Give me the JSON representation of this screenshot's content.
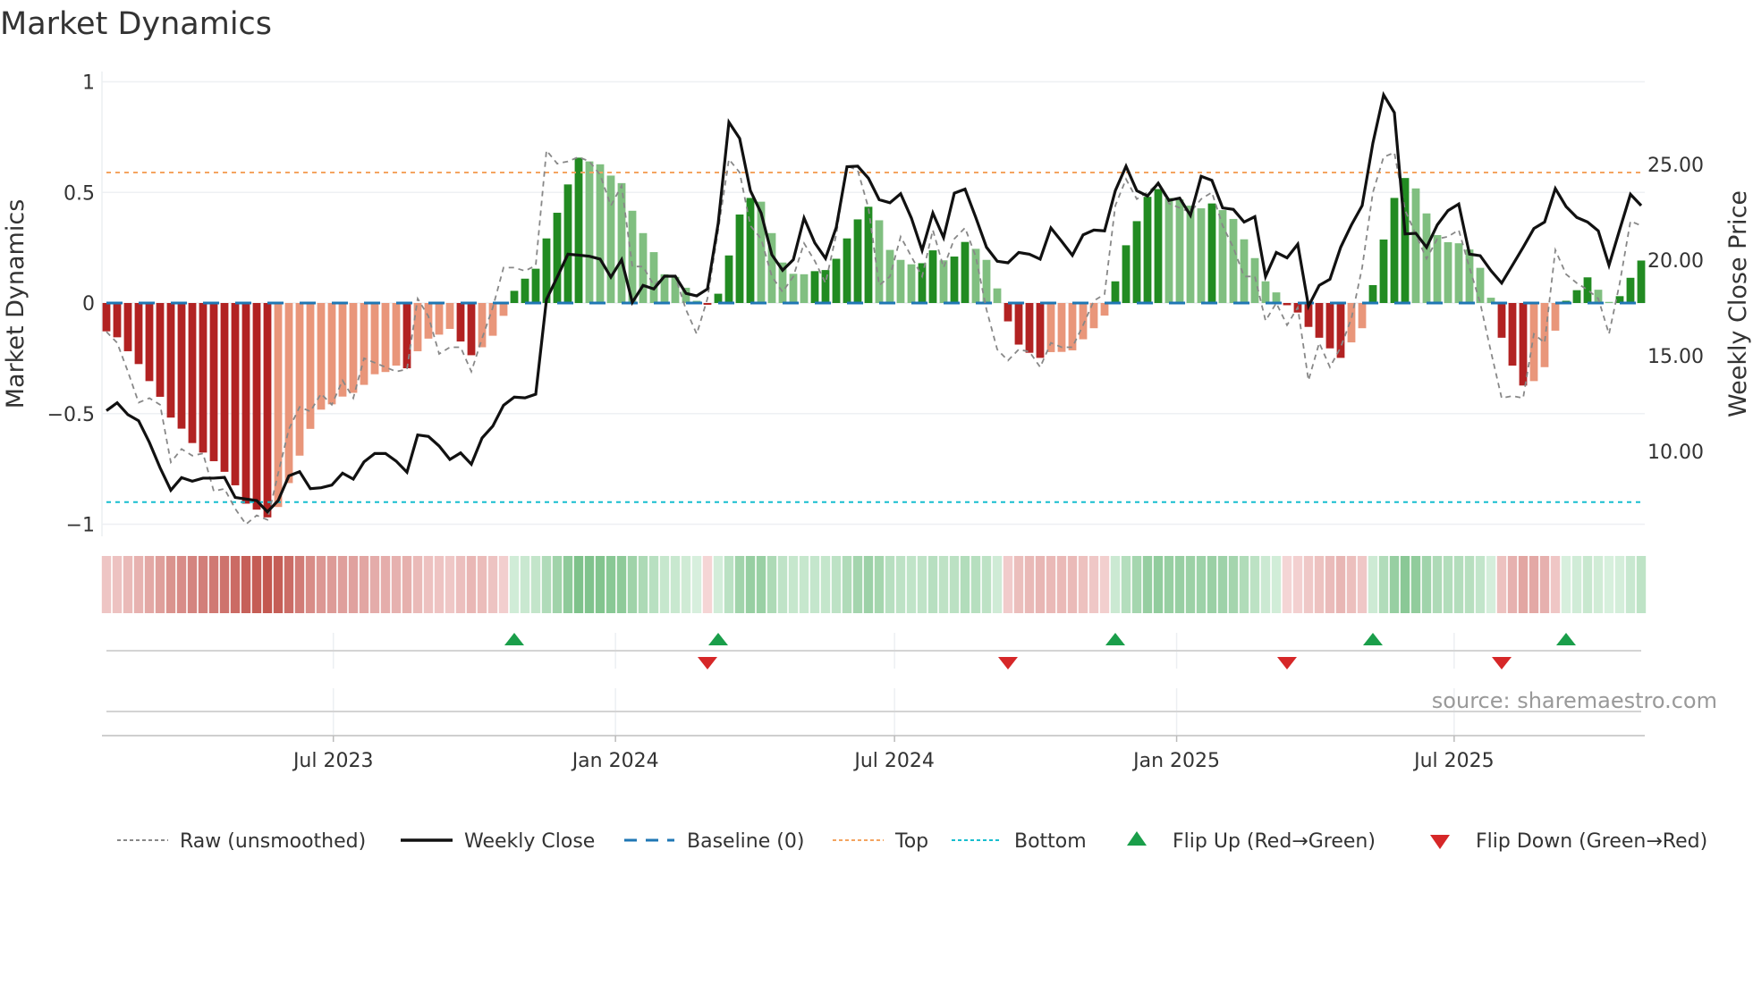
{
  "chart_data": {
    "type": "bar",
    "title": "Market Dynamics",
    "ylabel": "Market Dynamics",
    "y2label": "Weekly Close Price",
    "ylim": [
      -1,
      1
    ],
    "y2lim": [
      5.9,
      29.0
    ],
    "x_start": "2023-02-03",
    "x_interval_days": 7,
    "left_ticks": [
      {
        "value": 1,
        "label": "1"
      },
      {
        "value": 0.5,
        "label": "0.5"
      },
      {
        "value": 0,
        "label": "0"
      },
      {
        "value": -0.5,
        "label": "−0.5"
      },
      {
        "value": -1,
        "label": "−1"
      }
    ],
    "right_ticks": [
      {
        "value": 25,
        "label": "25.00"
      },
      {
        "value": 20,
        "label": "20.00"
      },
      {
        "value": 15,
        "label": "15.00"
      },
      {
        "value": 10,
        "label": "10.00"
      }
    ],
    "x_ticks": [
      {
        "date": "2023-07-01",
        "label": "Jul 2023"
      },
      {
        "date": "2024-01-01",
        "label": "Jan 2024"
      },
      {
        "date": "2024-07-01",
        "label": "Jul 2024"
      },
      {
        "date": "2025-01-01",
        "label": "Jan 2025"
      },
      {
        "date": "2025-07-01",
        "label": "Jul 2025"
      }
    ],
    "top_level": 0.59,
    "bottom_level": -0.9,
    "baseline": 0,
    "dynamics": [
      -0.128,
      -0.155,
      -0.218,
      -0.276,
      -0.353,
      -0.424,
      -0.518,
      -0.568,
      -0.633,
      -0.676,
      -0.715,
      -0.763,
      -0.824,
      -0.907,
      -0.934,
      -0.969,
      -0.922,
      -0.814,
      -0.69,
      -0.569,
      -0.482,
      -0.458,
      -0.423,
      -0.406,
      -0.37,
      -0.322,
      -0.312,
      -0.283,
      -0.295,
      -0.218,
      -0.161,
      -0.143,
      -0.117,
      -0.174,
      -0.236,
      -0.2,
      -0.148,
      -0.058,
      0.055,
      0.11,
      0.155,
      0.292,
      0.408,
      0.536,
      0.657,
      0.64,
      0.627,
      0.576,
      0.542,
      0.417,
      0.316,
      0.23,
      0.13,
      0.118,
      0.069,
      0.01,
      -0.008,
      0.042,
      0.215,
      0.4,
      0.475,
      0.458,
      0.316,
      0.183,
      0.132,
      0.13,
      0.144,
      0.149,
      0.2,
      0.292,
      0.378,
      0.435,
      0.374,
      0.24,
      0.195,
      0.175,
      0.18,
      0.238,
      0.193,
      0.21,
      0.276,
      0.245,
      0.195,
      0.066,
      -0.083,
      -0.188,
      -0.225,
      -0.248,
      -0.222,
      -0.221,
      -0.214,
      -0.164,
      -0.114,
      -0.057,
      0.098,
      0.261,
      0.37,
      0.48,
      0.515,
      0.475,
      0.468,
      0.44,
      0.428,
      0.45,
      0.42,
      0.38,
      0.288,
      0.203,
      0.098,
      0.048,
      -0.01,
      -0.043,
      -0.108,
      -0.157,
      -0.205,
      -0.248,
      -0.178,
      -0.114,
      0.081,
      0.287,
      0.475,
      0.565,
      0.518,
      0.405,
      0.307,
      0.275,
      0.27,
      0.242,
      0.159,
      0.024,
      -0.157,
      -0.283,
      -0.373,
      -0.353,
      -0.29,
      -0.125,
      0.01,
      0.058,
      0.116,
      0.06,
      0.005,
      0.031,
      0.114,
      0.192
    ],
    "raw": [
      -0.13,
      -0.18,
      -0.31,
      -0.45,
      -0.43,
      -0.46,
      -0.72,
      -0.66,
      -0.69,
      -0.68,
      -0.85,
      -0.84,
      -0.93,
      -1.0,
      -0.96,
      -0.98,
      -0.77,
      -0.57,
      -0.47,
      -0.49,
      -0.41,
      -0.46,
      -0.35,
      -0.43,
      -0.25,
      -0.27,
      -0.29,
      -0.31,
      -0.3,
      0.02,
      -0.06,
      -0.23,
      -0.2,
      -0.2,
      -0.31,
      -0.16,
      -0.02,
      0.16,
      0.16,
      0.145,
      0.17,
      0.69,
      0.63,
      0.64,
      0.66,
      0.64,
      0.58,
      0.44,
      0.53,
      0.165,
      0.165,
      0.08,
      0.12,
      0.12,
      -0.03,
      -0.14,
      0.02,
      0.33,
      0.65,
      0.59,
      0.35,
      0.29,
      0.12,
      0.05,
      0.12,
      0.27,
      0.19,
      0.09,
      0.31,
      0.62,
      0.6,
      0.43,
      0.08,
      0.12,
      0.3,
      0.21,
      0.12,
      0.33,
      0.16,
      0.29,
      0.34,
      0.21,
      -0.03,
      -0.21,
      -0.26,
      -0.21,
      -0.22,
      -0.29,
      -0.18,
      -0.2,
      -0.2,
      -0.1,
      0.01,
      0.04,
      0.44,
      0.56,
      0.47,
      0.5,
      0.54,
      0.45,
      0.43,
      0.41,
      0.47,
      0.5,
      0.35,
      0.25,
      0.12,
      0.12,
      -0.08,
      0.0,
      -0.1,
      -0.02,
      -0.35,
      -0.18,
      -0.29,
      -0.2,
      -0.07,
      0.16,
      0.5,
      0.66,
      0.68,
      0.42,
      0.31,
      0.2,
      0.29,
      0.3,
      0.33,
      0.16,
      0.0,
      -0.22,
      -0.43,
      -0.42,
      -0.43,
      -0.14,
      -0.18,
      0.24,
      0.13,
      0.09,
      0.06,
      0.02,
      -0.14,
      0.09,
      0.37,
      0.35
    ],
    "weekly_close": [
      12.13,
      12.54,
      11.92,
      11.6,
      10.47,
      9.14,
      7.97,
      8.63,
      8.44,
      8.6,
      8.6,
      8.64,
      7.59,
      7.51,
      7.43,
      6.84,
      7.43,
      8.72,
      8.94,
      8.05,
      8.1,
      8.24,
      8.86,
      8.55,
      9.45,
      9.89,
      9.89,
      9.49,
      8.91,
      10.86,
      10.78,
      10.28,
      9.58,
      9.92,
      9.33,
      10.7,
      11.32,
      12.41,
      12.84,
      12.8,
      12.99,
      17.94,
      19.11,
      20.31,
      20.26,
      20.2,
      20.05,
      19.11,
      20.02,
      17.79,
      18.68,
      18.49,
      19.16,
      19.16,
      18.26,
      18.13,
      18.49,
      21.92,
      27.21,
      26.36,
      23.63,
      22.46,
      20.28,
      19.47,
      20.02,
      22.2,
      20.9,
      20.09,
      21.71,
      24.88,
      24.91,
      24.28,
      23.16,
      23.0,
      23.47,
      22.2,
      20.51,
      22.46,
      21.18,
      23.5,
      23.71,
      22.23,
      20.67,
      19.94,
      19.86,
      20.4,
      20.31,
      20.05,
      21.68,
      20.98,
      20.25,
      21.32,
      21.57,
      21.53,
      23.63,
      24.91,
      23.63,
      23.35,
      24.02,
      23.12,
      23.24,
      22.34,
      24.38,
      24.17,
      22.73,
      22.65,
      21.99,
      22.27,
      19.14,
      20.4,
      20.12,
      20.83,
      17.59,
      18.68,
      19.0,
      20.67,
      21.84,
      22.85,
      26.12,
      28.64,
      27.71,
      21.37,
      21.4,
      20.67,
      21.84,
      22.59,
      22.93,
      20.31,
      20.23,
      19.45,
      18.8,
      19.73,
      20.67,
      21.65,
      21.99,
      23.74,
      22.8,
      22.23,
      21.99,
      21.53,
      19.73,
      21.6,
      23.44,
      22.85
    ],
    "flip_up_weeks": [
      39,
      58,
      95,
      119,
      137
    ],
    "flip_down_weeks": [
      57,
      85,
      111,
      131
    ],
    "legend": {
      "placement": "bottom",
      "items": [
        {
          "label": "Raw (unsmoothed)"
        },
        {
          "label": "Weekly Close"
        },
        {
          "label": "Baseline (0)"
        },
        {
          "label": "Top"
        },
        {
          "label": "Bottom"
        },
        {
          "label": "Flip Up (Red→Green)"
        },
        {
          "label": "Flip Down (Green→Red)"
        }
      ]
    },
    "source": "source: sharemaestro.com",
    "colors": {
      "pos_strong": "#228b22",
      "pos_weak": "#80bf80",
      "neg_strong": "#b22222",
      "neg_weak": "#e9967a",
      "raw": "#888888",
      "close": "#111111",
      "baseline": "#1f77b4",
      "top": "#f4a460",
      "bottom": "#17becf",
      "flip_up": "#1a9e4a",
      "flip_down": "#d62728"
    }
  }
}
